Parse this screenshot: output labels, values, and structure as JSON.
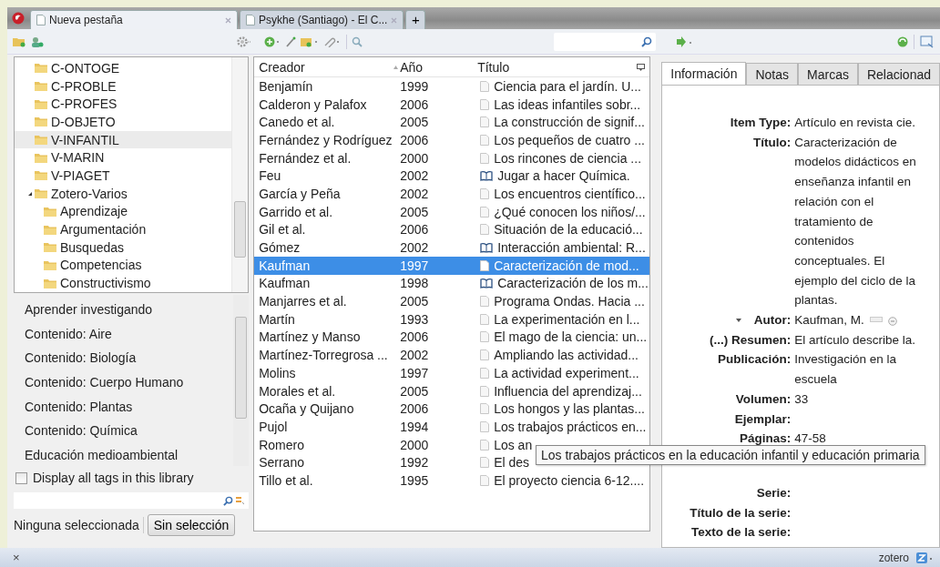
{
  "browser_tabs": [
    {
      "title": "Nueva pestaña",
      "selected": true
    },
    {
      "title": "Psykhe (Santiago) - El C...",
      "selected": false
    }
  ],
  "new_tab": "+",
  "collections": [
    {
      "name": "C-ONTOGE",
      "selected": false
    },
    {
      "name": "C-PROBLE",
      "selected": false
    },
    {
      "name": "C-PROFES",
      "selected": false
    },
    {
      "name": "D-OBJETO",
      "selected": false
    },
    {
      "name": "V-INFANTIL",
      "selected": true
    },
    {
      "name": "V-MARIN",
      "selected": false
    },
    {
      "name": "V-PIAGET",
      "selected": false
    },
    {
      "name": "Zotero-Varios",
      "selected": false,
      "expanded": true,
      "children": [
        {
          "name": "Aprendizaje",
          "selected": false
        },
        {
          "name": "Argumentación",
          "selected": false
        },
        {
          "name": "Busquedas",
          "selected": false
        },
        {
          "name": "Competencias",
          "selected": false
        },
        {
          "name": "Constructivismo",
          "selected": false
        }
      ]
    }
  ],
  "tags": [
    "Aprender investigando",
    "Contenido: Aire",
    "Contenido: Biología",
    "Contenido: Cuerpo Humano",
    "Contenido: Plantas",
    "Contenido: Química",
    "Educación medioambiental"
  ],
  "display_all_tags": {
    "label": "Display all tags in this library",
    "checked": false
  },
  "tag_status": "Ninguna seleccionada",
  "deselect_button": "Sin selección",
  "items": {
    "columns": [
      "Creador",
      "Año",
      "Título"
    ],
    "rows": [
      {
        "creator": "Benjamín",
        "year": "1999",
        "title": "Ciencia para el jardín. U...",
        "kind": "document",
        "selected": false
      },
      {
        "creator": "Calderon y Palafox",
        "year": "2006",
        "title": "Las ideas infantiles sobr...",
        "kind": "document",
        "selected": false
      },
      {
        "creator": "Canedo et al.",
        "year": "2005",
        "title": "La construcción de signif...",
        "kind": "document",
        "selected": false
      },
      {
        "creator": "Fernández y Rodríguez",
        "year": "2006",
        "title": "Los pequeños de cuatro ...",
        "kind": "document",
        "selected": false
      },
      {
        "creator": "Fernández et al.",
        "year": "2000",
        "title": "Los rincones de ciencia ...",
        "kind": "document",
        "selected": false
      },
      {
        "creator": "Feu",
        "year": "2002",
        "title": "Jugar a hacer Química.",
        "kind": "book",
        "selected": false
      },
      {
        "creator": "García y Peña",
        "year": "2002",
        "title": "Los encuentros científico...",
        "kind": "document",
        "selected": false
      },
      {
        "creator": "Garrido et al.",
        "year": "2005",
        "title": "¿Qué conocen los niños/...",
        "kind": "document",
        "selected": false
      },
      {
        "creator": "Gil et al.",
        "year": "2006",
        "title": "Situación de la educació...",
        "kind": "document",
        "selected": false
      },
      {
        "creator": "Gómez",
        "year": "2002",
        "title": "Interacción ambiental: R...",
        "kind": "book",
        "selected": false
      },
      {
        "creator": "Kaufman",
        "year": "1997",
        "title": "Caracterización de mod...",
        "kind": "document",
        "selected": true
      },
      {
        "creator": "Kaufman",
        "year": "1998",
        "title": "Caracterización de los m...",
        "kind": "book",
        "selected": false
      },
      {
        "creator": "Manjarres et al.",
        "year": "2005",
        "title": "Programa Ondas. Hacia ...",
        "kind": "document",
        "selected": false
      },
      {
        "creator": "Martín",
        "year": "1993",
        "title": "La experimentación en l...",
        "kind": "document",
        "selected": false
      },
      {
        "creator": "Martínez y Manso",
        "year": "2006",
        "title": "El mago de la ciencia: un...",
        "kind": "document",
        "selected": false
      },
      {
        "creator": "Martínez-Torregrosa ...",
        "year": "2002",
        "title": "Ampliando las actividad...",
        "kind": "document",
        "selected": false
      },
      {
        "creator": "Molins",
        "year": "1997",
        "title": "La actividad experiment...",
        "kind": "document",
        "selected": false
      },
      {
        "creator": "Morales et al.",
        "year": "2005",
        "title": "Influencia del aprendizaj...",
        "kind": "document",
        "selected": false
      },
      {
        "creator": "Ocaña y Quijano",
        "year": "2006",
        "title": "Los hongos y las plantas...",
        "kind": "document",
        "selected": false
      },
      {
        "creator": "Pujol",
        "year": "1994",
        "title": "Los trabajos prácticos en...",
        "kind": "document",
        "selected": false
      },
      {
        "creator": "Romero",
        "year": "2000",
        "title": "Los an",
        "kind": "document",
        "selected": false
      },
      {
        "creator": "Serrano",
        "year": "1992",
        "title": "El des",
        "kind": "document",
        "selected": false
      },
      {
        "creator": "Tillo et al.",
        "year": "1995",
        "title": "El proyecto ciencia 6-12....",
        "kind": "document",
        "selected": false
      }
    ]
  },
  "info_tabs": [
    {
      "label": "Información",
      "selected": true
    },
    {
      "label": "Notas",
      "selected": false
    },
    {
      "label": "Marcas",
      "selected": false
    },
    {
      "label": "Relacionad",
      "selected": false
    }
  ],
  "fields": [
    {
      "label": "Item Type:",
      "kind": "plain",
      "lines": [
        "Artículo en revista cie."
      ]
    },
    {
      "label": "Título:",
      "kind": "plain",
      "lines": [
        "Caracterización de",
        "modelos didácticos en",
        "enseñanza infantil en",
        "relación con el",
        "tratamiento de",
        "contenidos",
        "conceptuales. El",
        "ejemplo del ciclo de la",
        "plantas."
      ]
    },
    {
      "label": "Autor:",
      "kind": "creator",
      "lines": [
        "Kaufman, M."
      ]
    },
    {
      "label": "(...) Resumen:",
      "kind": "plain",
      "lines": [
        "El artículo describe la."
      ]
    },
    {
      "label": "Publicación:",
      "kind": "plain",
      "lines": [
        "Investigación en la",
        "escuela"
      ]
    },
    {
      "label": "Volumen:",
      "kind": "plain",
      "lines": [
        "33"
      ]
    },
    {
      "label": "Ejemplar:",
      "kind": "plain"
    },
    {
      "label": "Páginas:",
      "kind": "covered",
      "lines": [
        "47-58"
      ]
    },
    {
      "label": "Serie:",
      "kind": "plain"
    },
    {
      "label": "Título de la serie:",
      "kind": "plain"
    },
    {
      "label": "Texto de la serie:",
      "kind": "plain"
    }
  ],
  "tooltip": "Los trabajos prácticos en la educación infantil y educación primaria",
  "status_bar": {
    "close": "×",
    "brand": "zotero"
  }
}
